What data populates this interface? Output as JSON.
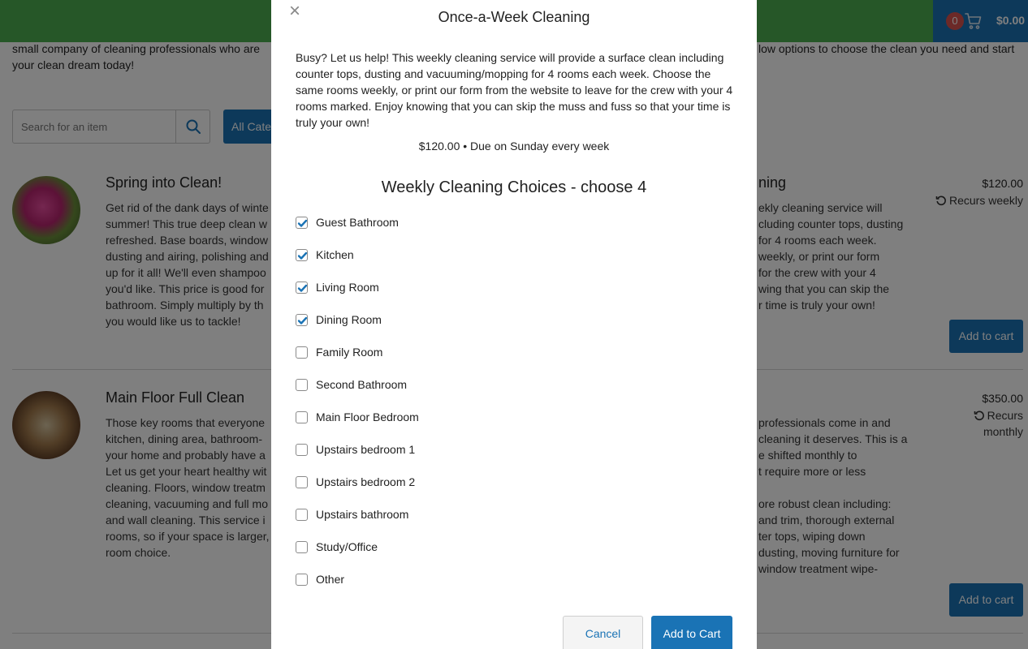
{
  "header": {
    "cart_count": "0",
    "cart_total": "$0.00"
  },
  "intro": {
    "left_text": "small company of cleaning professionals who are your clean dream today!",
    "right_text": "low options to choose the clean you need and start"
  },
  "search": {
    "placeholder": "Search for an item",
    "category_label": "All Categories"
  },
  "items": [
    {
      "title": "Spring into Clean!",
      "desc_lines": [
        "Get rid of the dank days of winte",
        "summer! This true deep clean w",
        "refreshed. Base boards, window",
        "dusting and airing, polishing and",
        "up for it all! We'll even shampoo",
        "you'd like. This price is good for",
        "bathroom.  Simply multiply by th",
        "you would like us to tackle!"
      ]
    },
    {
      "title": "Main Floor Full Clean",
      "desc_lines": [
        "Those key rooms that everyone",
        "kitchen, dining area, bathroom-",
        "your home and probably have a",
        "Let us get your heart healthy wit",
        "cleaning.  Floors, window treatm",
        "cleaning, vacuuming and full mo",
        "and wall cleaning.  This service i",
        "rooms, so if your space is larger,",
        "room choice."
      ]
    }
  ],
  "right_items": [
    {
      "title_fragment": "ning",
      "desc_lines": [
        "ekly cleaning service will",
        "cluding counter tops, dusting",
        "for 4 rooms each week.",
        "weekly, or print our form",
        "for the crew with your 4",
        "wing that you can skip the",
        "r time is truly your own!"
      ],
      "price": "$120.00",
      "recur": "Recurs weekly",
      "button": "Add to cart"
    },
    {
      "desc_lines": [
        "professionals come in and",
        "cleaning it deserves.  This is a",
        "e shifted monthly to",
        "t require more or less",
        "",
        "ore robust clean including:",
        "and trim, thorough external",
        "ter tops, wiping down",
        "dusting, moving furniture for",
        "window treatment wipe-"
      ],
      "price": "$350.00",
      "recur_line1": "Recurs",
      "recur_line2": "monthly",
      "button": "Add to cart"
    }
  ],
  "modal": {
    "close_label": "×",
    "title": "Once-a-Week Cleaning",
    "description": "Busy? Let us help! This weekly cleaning service will provide a surface clean including counter tops, dusting and vacuuming/mopping for 4 rooms each week.  Choose the same rooms weekly, or print our form from the website to leave for the crew with your 4 rooms marked. Enjoy knowing that you can skip the muss and fuss so that your time is truly your own!",
    "price_line": "$120.00 • Due on Sunday every week",
    "choices_title": "Weekly Cleaning Choices - choose 4",
    "choices": [
      {
        "label": "Guest Bathroom",
        "checked": true
      },
      {
        "label": "Kitchen",
        "checked": true
      },
      {
        "label": "Living Room",
        "checked": true
      },
      {
        "label": "Dining Room",
        "checked": true
      },
      {
        "label": "Family Room",
        "checked": false
      },
      {
        "label": "Second Bathroom",
        "checked": false
      },
      {
        "label": "Main Floor Bedroom",
        "checked": false
      },
      {
        "label": "Upstairs bedroom 1",
        "checked": false
      },
      {
        "label": "Upstairs bedroom 2",
        "checked": false
      },
      {
        "label": "Upstairs bathroom",
        "checked": false
      },
      {
        "label": "Study/Office",
        "checked": false
      },
      {
        "label": "Other",
        "checked": false
      }
    ],
    "cancel_label": "Cancel",
    "add_label": "Add to Cart"
  },
  "colors": {
    "header_green": "#4caf50",
    "primary_blue": "#1a73b5",
    "badge_red": "#d9534f"
  }
}
